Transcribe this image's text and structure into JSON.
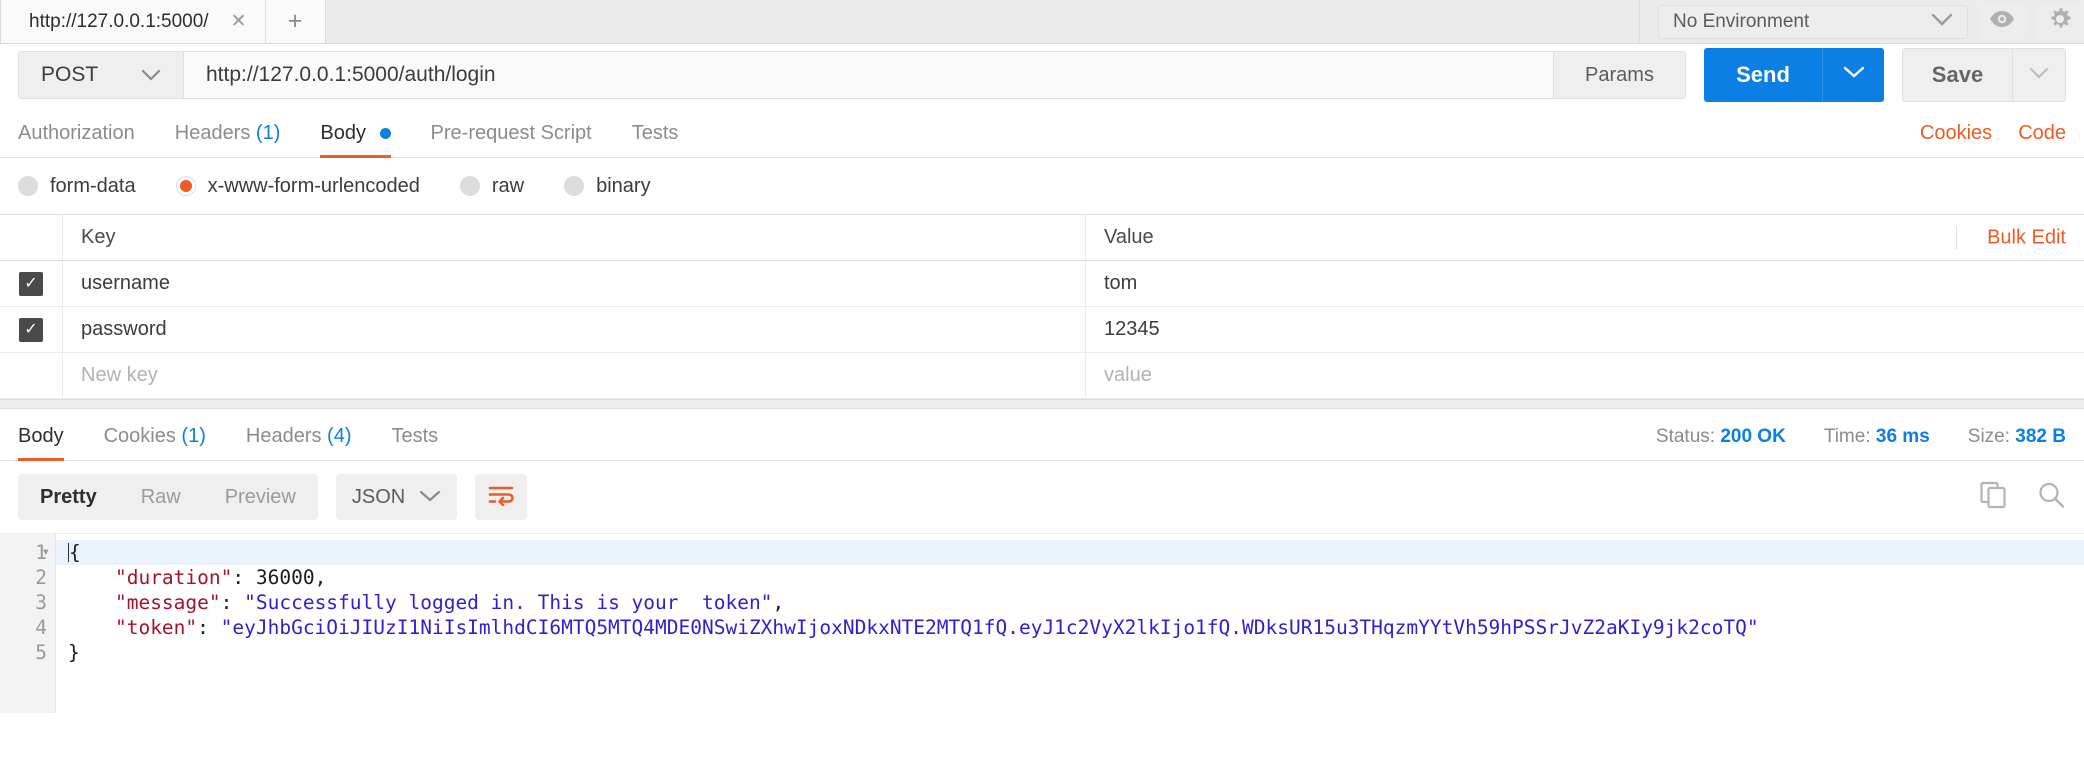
{
  "window": {
    "tab": {
      "title": "http://127.0.0.1:5000/",
      "close_icon": "close-icon"
    },
    "new_tab_icon": "plus-icon",
    "environment": {
      "selected": "No Environment",
      "caret_icon": "chevron-down-icon",
      "eye_icon": "eye-icon",
      "gear_icon": "gear-icon"
    }
  },
  "request": {
    "method": "POST",
    "method_caret_icon": "chevron-down-icon",
    "url": "http://127.0.0.1:5000/auth/login",
    "params_label": "Params",
    "send_label": "Send",
    "send_caret_icon": "chevron-down-icon",
    "save_label": "Save",
    "save_caret_icon": "chevron-down-icon",
    "tabs": [
      {
        "label": "Authorization",
        "count": "",
        "active": false
      },
      {
        "label": "Headers",
        "count": "(1)",
        "active": false
      },
      {
        "label": "Body",
        "count": "",
        "active": true,
        "dot": true
      },
      {
        "label": "Pre-request Script",
        "count": "",
        "active": false
      },
      {
        "label": "Tests",
        "count": "",
        "active": false
      }
    ],
    "cookies_link": "Cookies",
    "code_link": "Code",
    "body_types": [
      {
        "label": "form-data",
        "selected": false
      },
      {
        "label": "x-www-form-urlencoded",
        "selected": true
      },
      {
        "label": "raw",
        "selected": false
      },
      {
        "label": "binary",
        "selected": false
      }
    ],
    "table": {
      "headers": {
        "key": "Key",
        "value": "Value"
      },
      "bulk_edit": "Bulk Edit",
      "rows": [
        {
          "checked": true,
          "key": "username",
          "value": "tom"
        },
        {
          "checked": true,
          "key": "password",
          "value": "12345"
        }
      ],
      "new_row": {
        "key_placeholder": "New key",
        "value_placeholder": "value"
      }
    }
  },
  "response": {
    "tabs": [
      {
        "label": "Body",
        "count": "",
        "active": true
      },
      {
        "label": "Cookies",
        "count": "(1)",
        "active": false
      },
      {
        "label": "Headers",
        "count": "(4)",
        "active": false
      },
      {
        "label": "Tests",
        "count": "",
        "active": false
      }
    ],
    "meta": {
      "status_label": "Status:",
      "status_value": "200 OK",
      "time_label": "Time:",
      "time_value": "36 ms",
      "size_label": "Size:",
      "size_value": "382 B"
    },
    "view_modes": [
      {
        "label": "Pretty",
        "active": true
      },
      {
        "label": "Raw",
        "active": false
      },
      {
        "label": "Preview",
        "active": false
      }
    ],
    "format": "JSON",
    "format_caret_icon": "chevron-down-icon",
    "wrap_icon": "word-wrap-icon",
    "copy_icon": "copy-icon",
    "search_icon": "search-icon",
    "line_numbers": [
      "1",
      "2",
      "3",
      "4",
      "5"
    ],
    "body_lines": [
      {
        "open": "{"
      },
      {
        "key": "\"duration\"",
        "sep": ": ",
        "num": "36000",
        "tail": ","
      },
      {
        "key": "\"message\"",
        "sep": ": ",
        "str": "\"Successfully logged in. This is your  token\"",
        "tail": ","
      },
      {
        "key": "\"token\"",
        "sep": ": ",
        "str": "\"eyJhbGciOiJIUzI1NiIsImlhdCI6MTQ5MTQ4MDE0NSwiZXhwIjoxNDkxNTE2MTQ1fQ.eyJ1c2VyX2lkIjo1fQ.WDksUR15u3THqzmYYtVh59hPSSrJvZ2aKIy9jk2coTQ\""
      },
      {
        "close": "}"
      }
    ]
  },
  "colors": {
    "accent_orange": "#ef5b25",
    "accent_blue": "#0b7fe3",
    "json_string": "#2f1fd1",
    "json_key": "#a3142b"
  }
}
